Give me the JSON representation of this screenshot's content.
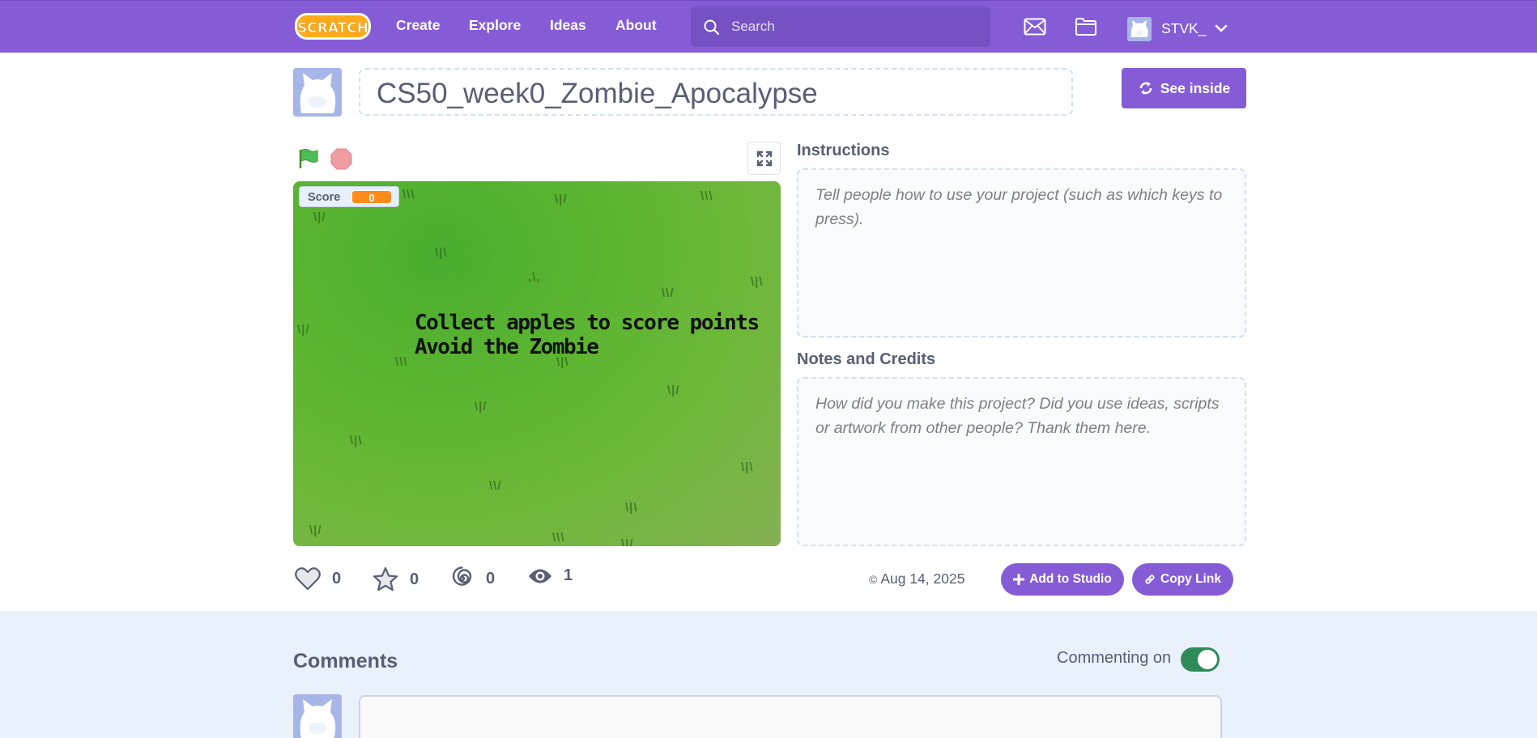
{
  "nav": {
    "logo_text": "SCRATCH",
    "links": [
      "Create",
      "Explore",
      "Ideas",
      "About"
    ],
    "search_placeholder": "Search",
    "username": "STVK_",
    "icons": [
      "messages-icon",
      "my-stuff-icon",
      "chevron-down-icon"
    ]
  },
  "project": {
    "title": "CS50_week0_Zombie_Apocalypse",
    "see_inside_label": "See inside"
  },
  "stage": {
    "score_label": "Score",
    "score_value": "0",
    "text_line1": "Collect apples to score points",
    "text_line2": "Avoid the Zombie"
  },
  "instructions": {
    "label": "Instructions",
    "placeholder": "Tell people how to use your project (such as which keys to press)."
  },
  "notes": {
    "label": "Notes and Credits",
    "placeholder": "How did you make this project? Did you use ideas, scripts or artwork from other people? Thank them here."
  },
  "stats": {
    "loves": "0",
    "favorites": "0",
    "remixes": "0",
    "views": "1",
    "date": "Aug 14, 2025"
  },
  "actions": {
    "add_to_studio": "Add to Studio",
    "copy_link": "Copy Link"
  },
  "comments": {
    "title": "Comments",
    "commenting_label": "Commenting on",
    "commenting_enabled": true
  },
  "colors": {
    "brand_purple": "#855cd6",
    "score_orange": "#ff8c1a",
    "toggle_green": "#2e8b57",
    "comments_bg": "#e9f1fc"
  }
}
